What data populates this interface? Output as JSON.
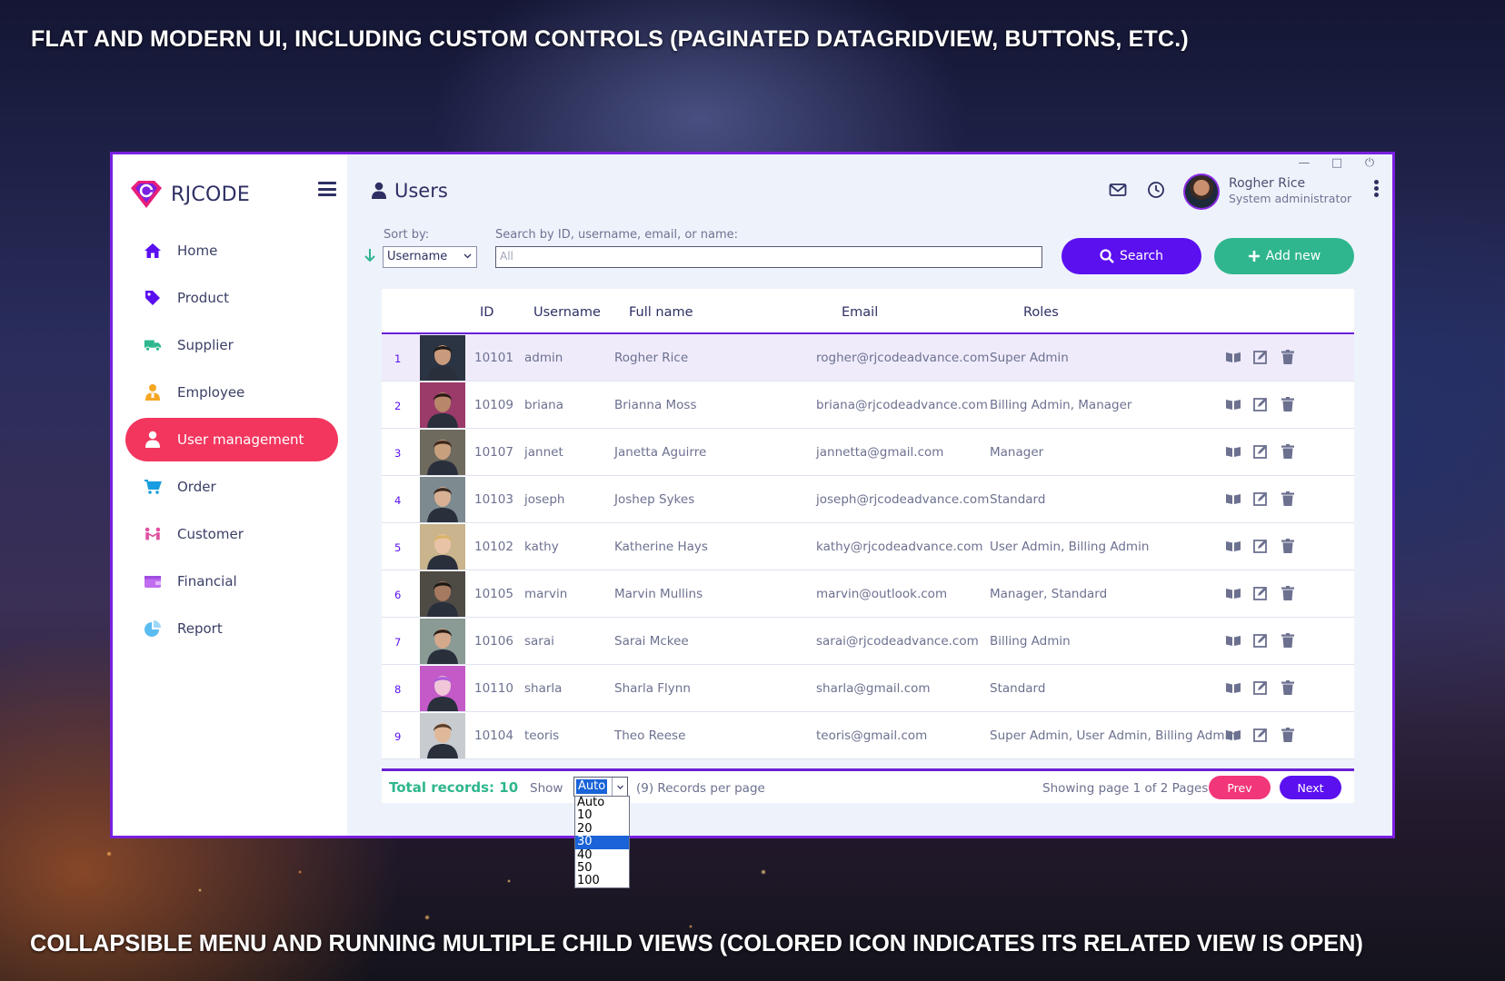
{
  "captions": {
    "top": "FLAT AND MODERN UI, INCLUDING CUSTOM CONTROLS (PAGINATED DATAGRIDVIEW, BUTTONS, ETC.)",
    "bottom": "COLLAPSIBLE MENU AND RUNNING MULTIPLE CHILD VIEWS (COLORED ICON INDICATES ITS RELATED VIEW IS OPEN)"
  },
  "brand": {
    "name": "RJCODE"
  },
  "sidebar": {
    "items": [
      {
        "label": "Home",
        "icon": "home-icon",
        "color": "#5b10f0"
      },
      {
        "label": "Product",
        "icon": "tag-icon",
        "color": "#5b10f0"
      },
      {
        "label": "Supplier",
        "icon": "truck-icon",
        "color": "#2fb68e"
      },
      {
        "label": "Employee",
        "icon": "employee-icon",
        "color": "#f5a623"
      },
      {
        "label": "User management",
        "icon": "user-icon",
        "color": "#ffffff",
        "active": true
      },
      {
        "label": "Order",
        "icon": "cart-icon",
        "color": "#1a9de0"
      },
      {
        "label": "Customer",
        "icon": "customer-icon",
        "color": "#e04fa0"
      },
      {
        "label": "Financial",
        "icon": "wallet-icon",
        "color": "#c06cf0"
      },
      {
        "label": "Report",
        "icon": "pie-chart-icon",
        "color": "#5bbcf0"
      }
    ]
  },
  "header": {
    "title": "Users",
    "user_name": "Rogher Rice",
    "user_role": "System administrator"
  },
  "toolbar": {
    "sort_label": "Sort by:",
    "sort_value": "Username",
    "search_label": "Search by ID, username, email, or name:",
    "search_value": "All",
    "search_button": "Search",
    "add_button": "Add new"
  },
  "grid": {
    "columns": [
      "ID",
      "Username",
      "Full name",
      "Email",
      "Roles"
    ],
    "rows": [
      {
        "n": "1",
        "id": "10101",
        "username": "admin",
        "fullname": "Rogher Rice",
        "email": "rogher@rjcodeadvance.com",
        "roles": "Super Admin",
        "avatar_bg": "#2b3442",
        "skin": "#c99a7c",
        "hair": "#1d1a18"
      },
      {
        "n": "2",
        "id": "10109",
        "username": "briana",
        "fullname": "Brianna Moss",
        "email": "briana@rjcodeadvance.com",
        "roles": "Billing Admin, Manager",
        "avatar_bg": "#9a3b6a",
        "skin": "#b8876a",
        "hair": "#2a1a16"
      },
      {
        "n": "3",
        "id": "10107",
        "username": "jannet",
        "fullname": "Janetta Aguirre",
        "email": "jannetta@gmail.com",
        "roles": "Manager",
        "avatar_bg": "#6e6a5e",
        "skin": "#c9a07e",
        "hair": "#3b2618"
      },
      {
        "n": "4",
        "id": "10103",
        "username": "joseph",
        "fullname": "Joshep Sykes",
        "email": "joseph@rjcodeadvance.com",
        "roles": "Standard",
        "avatar_bg": "#7d8a90",
        "skin": "#d8b094",
        "hair": "#3a2b22"
      },
      {
        "n": "5",
        "id": "10102",
        "username": "kathy",
        "fullname": "Katherine Hays",
        "email": "kathy@rjcodeadvance.com",
        "roles": "User Admin, Billing Admin",
        "avatar_bg": "#c9b48e",
        "skin": "#e8c3a5",
        "hair": "#d9b46a"
      },
      {
        "n": "6",
        "id": "10105",
        "username": "marvin",
        "fullname": "Marvin Mullins",
        "email": "marvin@outlook.com",
        "roles": "Manager, Standard",
        "avatar_bg": "#4e4a44",
        "skin": "#a57a60",
        "hair": "#1c1714"
      },
      {
        "n": "7",
        "id": "10106",
        "username": "sarai",
        "fullname": "Sarai Mckee",
        "email": "sarai@rjcodeadvance.com",
        "roles": "Billing Admin",
        "avatar_bg": "#8a9a94",
        "skin": "#d4a88a",
        "hair": "#2a1c16"
      },
      {
        "n": "8",
        "id": "10110",
        "username": "sharla",
        "fullname": "Sharla Flynn",
        "email": "sharla@gmail.com",
        "roles": "Standard",
        "avatar_bg": "#c45ac8",
        "skin": "#f0c6d8",
        "hair": "#b05ad8"
      },
      {
        "n": "9",
        "id": "10104",
        "username": "teoris",
        "fullname": "Theo Reese",
        "email": "teoris@gmail.com",
        "roles": "Super Admin, User Admin, Billing Admin",
        "avatar_bg": "#c8ccd0",
        "skin": "#e0b89a",
        "hair": "#5a3e2a"
      }
    ]
  },
  "footer": {
    "total": "Total records: 10",
    "show": "Show",
    "page_size": "Auto",
    "per_page": "(9) Records per page",
    "pages": "Showing page 1 of 2 Pages",
    "prev": "Prev",
    "next": "Next"
  },
  "page_size_options": [
    "Auto",
    "10",
    "20",
    "30",
    "40",
    "50",
    "100"
  ],
  "page_size_highlighted": "30",
  "colors": {
    "accent": "#5b10f0",
    "active_menu": "#f2365e",
    "add": "#2fb68e",
    "border": "#7b1fe0"
  }
}
